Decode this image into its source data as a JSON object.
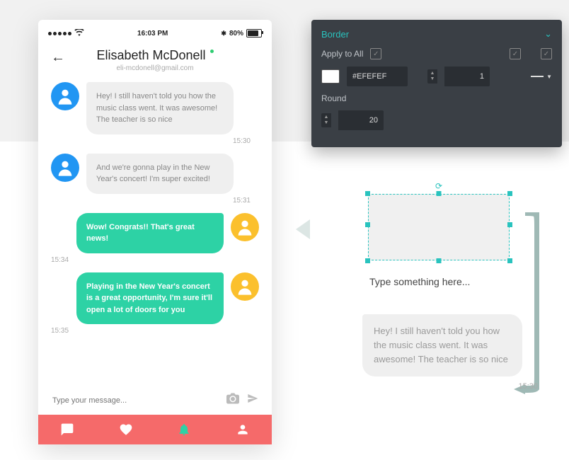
{
  "status": {
    "time": "16:03 PM",
    "battery": "80%",
    "bluetooth": "✱"
  },
  "header": {
    "name": "Elisabeth McDonell",
    "email": "eli-mcdonell@gmail.com"
  },
  "messages": [
    {
      "dir": "in",
      "text": "Hey! I still haven't told you how the music class went. It was awesome! The teacher is so nice",
      "time": "15:30"
    },
    {
      "dir": "in",
      "text": "And we're gonna play in the New Year's concert! I'm super excited!",
      "time": "15:31"
    },
    {
      "dir": "out",
      "text": "Wow! Congrats!! That's great news!",
      "time": "15:34"
    },
    {
      "dir": "out",
      "text": "Playing in the New Year's concert is a great opportunity, I'm sure it'll open a lot of doors for you",
      "time": "15:35"
    }
  ],
  "input": {
    "placeholder": "Type your message..."
  },
  "panel": {
    "title": "Border",
    "apply_label": "Apply to All",
    "hex": "#EFEFEF",
    "width": "1",
    "round_label": "Round",
    "round": "20"
  },
  "canvas": {
    "placeholder": "Type something here...",
    "example_text": "Hey! I still haven't told you how the music class went. It was awesome! The teacher is so nice",
    "example_time": "15:30"
  }
}
